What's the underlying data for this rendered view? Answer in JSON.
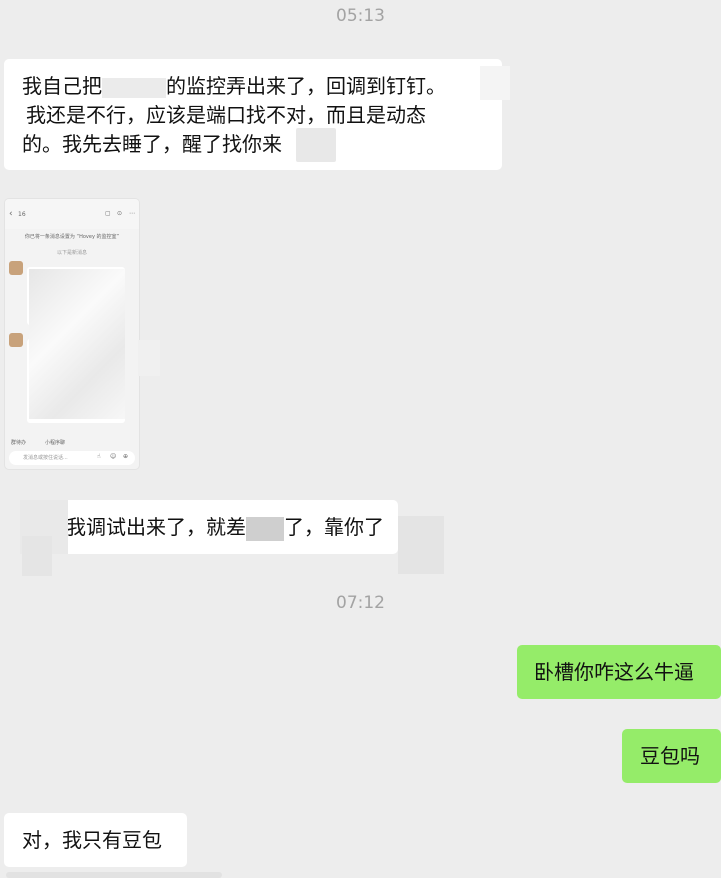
{
  "chat": {
    "timestamps": {
      "first": "05:13",
      "second": "07:12"
    },
    "messages": [
      {
        "side": "in",
        "lines": [
          "我自己把",
          "的监控弄出来了，回调到钉钉。",
          "我还是不行，应该是端口找不对，而且是动态",
          "的。我先去睡了，醒了找你来"
        ]
      },
      {
        "side": "in",
        "lines": [
          "我调试出来了，就差",
          "了，靠你了"
        ]
      },
      {
        "side": "out",
        "lines": [
          "卧槽你咋这么牛逼"
        ]
      },
      {
        "side": "out",
        "lines": [
          "豆包吗"
        ]
      },
      {
        "side": "in",
        "lines": [
          "对，我只有豆包"
        ]
      }
    ],
    "screenshot": {
      "header_back": "16",
      "header_note": "你已将一条消息设置为 “Hovey 的监控室”",
      "section_label": "以下是新消息",
      "footer_chips": [
        "群待办",
        "小程序聊"
      ],
      "input_placeholder": "发消息或按住说话..."
    }
  }
}
